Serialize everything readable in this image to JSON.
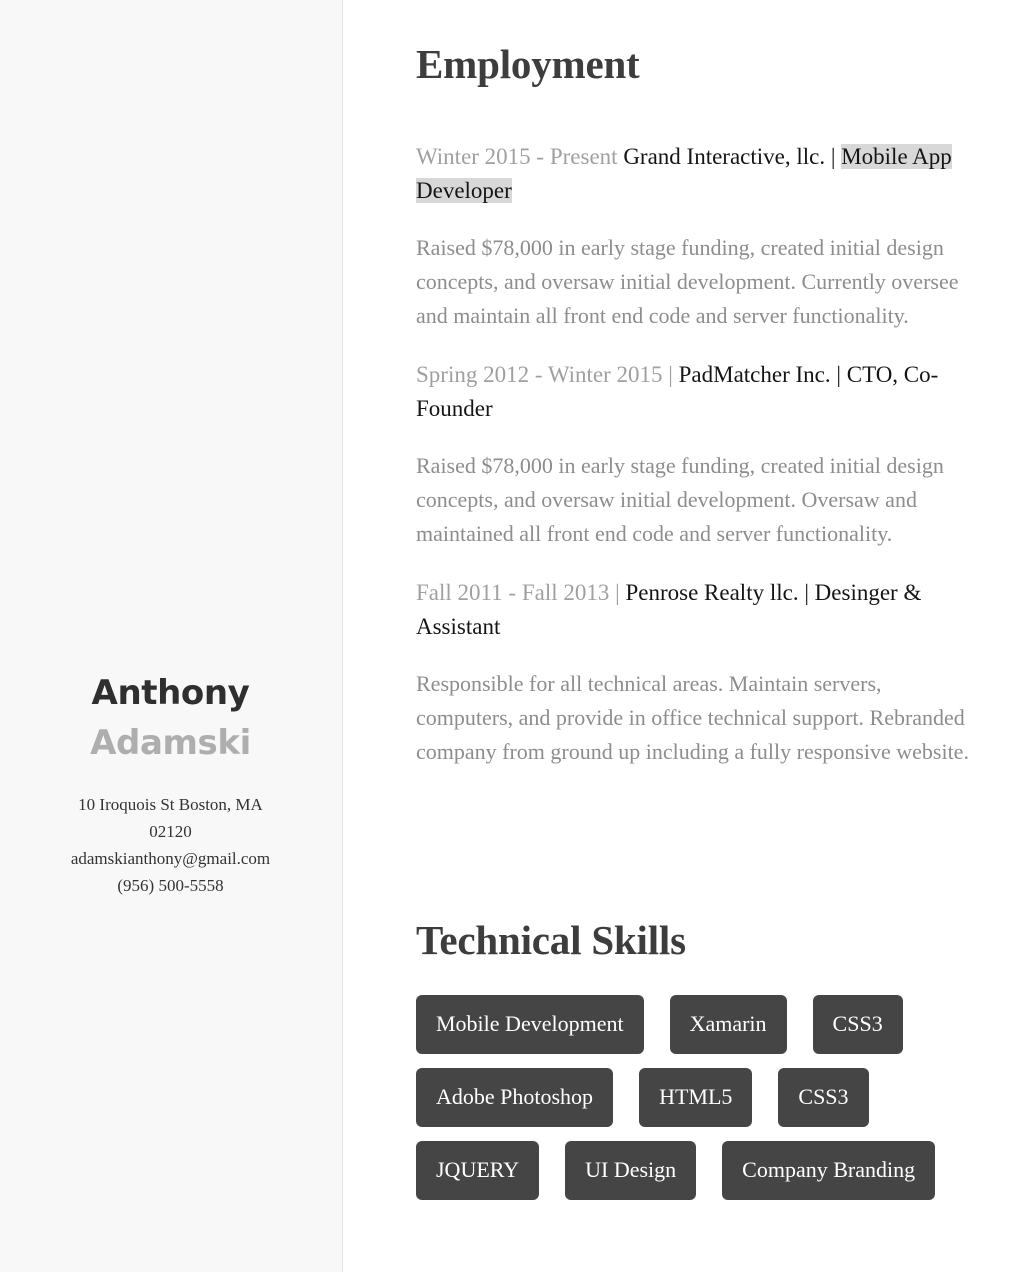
{
  "sidebar": {
    "name_first": "Anthony",
    "name_last": "Adamski",
    "contact": {
      "address_line1": "10 Iroquois St Boston, MA",
      "address_line2": "02120",
      "email": "adamskianthony@gmail.com",
      "phone": "(956) 500-5558"
    }
  },
  "employment": {
    "heading": "Employment",
    "jobs": [
      {
        "when": "Winter 2015 - Present",
        "title_plain": " Grand Interactive, llc. | ",
        "title_selected": "Mobile App Developer",
        "description": "Raised $78,000 in early stage funding, created initial design concepts, and oversaw initial development. Currently oversee and maintain all front end code and server functionality."
      },
      {
        "when": "Spring 2012 - Winter 2015 |",
        "title_plain": " PadMatcher Inc. | CTO, Co-Founder",
        "title_selected": "",
        "description": "Raised $78,000 in early stage funding, created initial design concepts, and oversaw initial development. Oversaw and maintained all front end code and server functionality."
      },
      {
        "when": "Fall 2011 - Fall 2013 |",
        "title_plain": " Penrose Realty llc. | Desinger & Assistant",
        "title_selected": "",
        "description": "Responsible for all technical areas. Maintain servers, computers, and provide in office technical support. Rebranded company from ground up including a fully responsive website."
      }
    ]
  },
  "skills": {
    "heading": "Technical Skills",
    "rows": [
      [
        "Mobile Development",
        "Xamarin",
        "CSS3"
      ],
      [
        "Adobe Photoshop",
        "HTML5",
        "CSS3"
      ],
      [
        "JQUERY",
        "UI Design",
        "Company Branding"
      ]
    ]
  },
  "colors": {
    "sidebar_background": "#f8f8f8",
    "divider": "#e4e4e4",
    "heading": "#3d3d3d",
    "body_text": "#8d8d8d",
    "date_text": "#a0a0a0",
    "name_first": "#2f2f2f",
    "name_last": "#aeaeae",
    "tag_background": "#454545",
    "tag_text": "#ffffff",
    "selection_highlight": "#d8d8d8"
  }
}
